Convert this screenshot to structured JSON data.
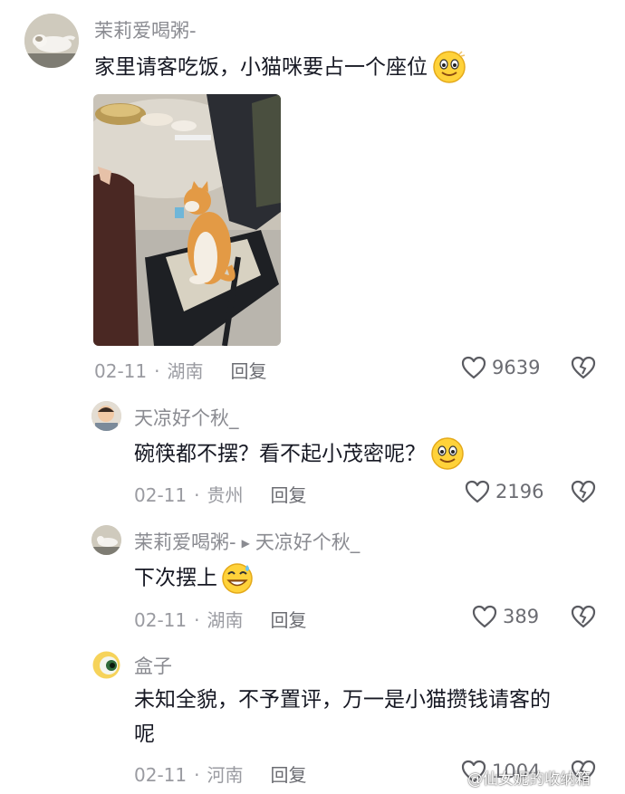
{
  "comments": [
    {
      "username": "茉莉爱喝粥-",
      "text": "家里请客吃饭，小猫咪要占一个座位",
      "date": "02-11",
      "location": "湖南",
      "reply_label": "回复",
      "likes": "9639"
    },
    {
      "username": "天凉好个秋_",
      "text": "碗筷都不摆？看不起小茂密呢？",
      "date": "02-11",
      "location": "贵州",
      "reply_label": "回复",
      "likes": "2196"
    },
    {
      "username": "茉莉爱喝粥-",
      "reply_to": "天凉好个秋_",
      "text": "下次摆上",
      "date": "02-11",
      "location": "湖南",
      "reply_label": "回复",
      "likes": "389"
    },
    {
      "username": "盒子",
      "text_line1": "未知全貌，不予置评，万一是小猫攒钱请客的",
      "text_line2": "呢",
      "date": "02-11",
      "location": "河南",
      "reply_label": "回复",
      "likes": "1004"
    }
  ],
  "meta_separator": "·",
  "watermark": "@仙女妮的收纳箱",
  "icons": {
    "like": "heart-outline-icon",
    "dislike": "broken-heart-icon",
    "emoji_smile": "smiling-face-emoji",
    "emoji_sweat": "grinning-sweat-emoji",
    "reply_arrow": "triangle-right-icon"
  },
  "colors": {
    "username": "#8a8b91",
    "text": "#161823",
    "meta": "#9a9ba1"
  }
}
